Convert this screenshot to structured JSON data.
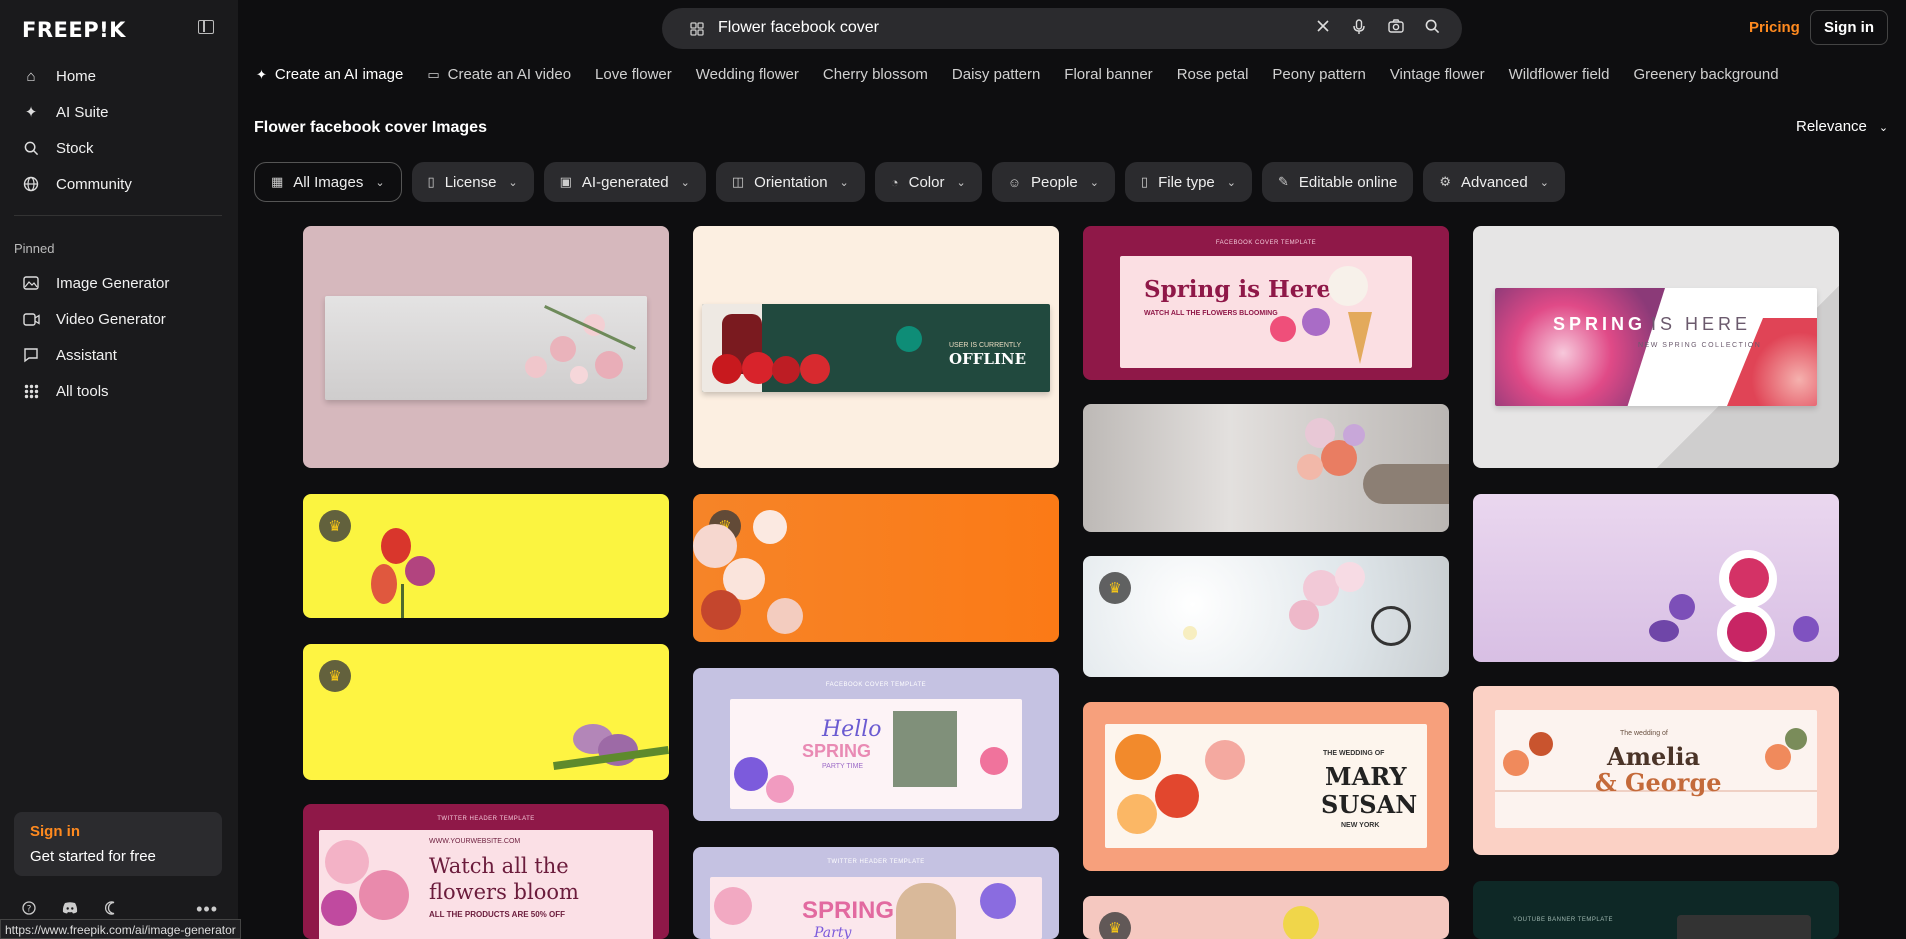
{
  "sidebar": {
    "logo": "FREEP!K",
    "nav": [
      {
        "label": "Home",
        "icon": "home-icon"
      },
      {
        "label": "AI Suite",
        "icon": "sparkle-icon"
      },
      {
        "label": "Stock",
        "icon": "search-icon"
      },
      {
        "label": "Community",
        "icon": "globe-icon"
      }
    ],
    "pinned_label": "Pinned",
    "pinned": [
      {
        "label": "Image Generator",
        "icon": "image-icon"
      },
      {
        "label": "Video Generator",
        "icon": "video-icon"
      },
      {
        "label": "Assistant",
        "icon": "chat-icon"
      },
      {
        "label": "All tools",
        "icon": "grid-icon"
      }
    ],
    "signin_title": "Sign in",
    "signin_subtitle": "Get started for free"
  },
  "status_url": "https://www.freepik.com/ai/image-generator",
  "search": {
    "value": "Flower facebook cover",
    "placeholder": ""
  },
  "header": {
    "pricing": "Pricing",
    "signin": "Sign in"
  },
  "suggestions": [
    "Create an AI image",
    "Create an AI video",
    "Love flower",
    "Wedding flower",
    "Cherry blossom",
    "Daisy pattern",
    "Floral banner",
    "Rose petal",
    "Peony pattern",
    "Vintage flower",
    "Wildflower field",
    "Greenery background"
  ],
  "results_title": "Flower facebook cover Images",
  "sort_label": "Relevance",
  "filters": [
    "All Images",
    "License",
    "AI-generated",
    "Orientation",
    "Color",
    "People",
    "File type",
    "Editable online",
    "Advanced"
  ],
  "cards": {
    "c2_line1": "User is currently",
    "c2_line2": "OFFLINE",
    "c3_head": "FACEBOOK COVER TEMPLATE",
    "c3_title": "Spring is Here!",
    "c3_sub": "WATCH ALL THE FLOWERS BLOOMING",
    "c4_title1": "SPRING",
    "c4_title2": "IS HERE",
    "c4_sub": "NEW SPRING COLLECTION",
    "c9_head": "FACEBOOK COVER TEMPLATE",
    "c9_hello": "Hello",
    "c9_spring": "SPRING",
    "c9_party": "PARTY TIME",
    "c10_small": "THE WEDDING OF",
    "c10_name1": "MARY",
    "c10_name2": "SUSAN",
    "c10_city": "NEW YORK",
    "c11_small": "The wedding of",
    "c11_name1": "Amelia",
    "c11_name2": "& George",
    "c12_head": "TWITTER HEADER TEMPLATE",
    "c12_url": "WWW.YOURWEBSITE.COM",
    "c12_title1": "Watch all the",
    "c12_title2": "flowers bloom",
    "c12_promo": "ALL THE PRODUCTS ARE 50% OFF",
    "c13_head": "TWITTER HEADER TEMPLATE",
    "c13_spring": "SPRING",
    "c13_party": "Party",
    "c15_head": "YOUTUBE BANNER TEMPLATE"
  }
}
